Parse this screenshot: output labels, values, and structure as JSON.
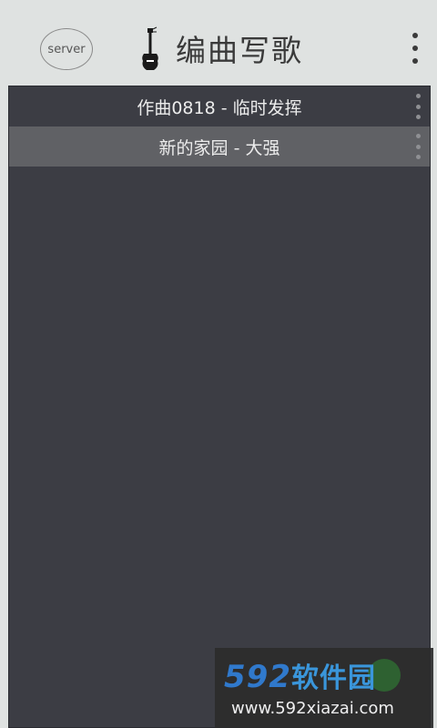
{
  "header": {
    "server_label": "server",
    "title": "编曲写歌",
    "guitar_icon": "guitar-icon",
    "menu_icon": "more-vertical-icon"
  },
  "songs": [
    {
      "title": "作曲0818 - 临时发挥",
      "selected": false
    },
    {
      "title": "新的家园 - 大强",
      "selected": true
    }
  ],
  "watermark": {
    "brand_num": "592",
    "brand_text": "软件园",
    "url": "www.592xiazai.com"
  },
  "colors": {
    "background": "#dfe2e1",
    "panel": "#3c3d44",
    "selected_row": "#606165",
    "brand_blue": "#2f7fd8"
  }
}
